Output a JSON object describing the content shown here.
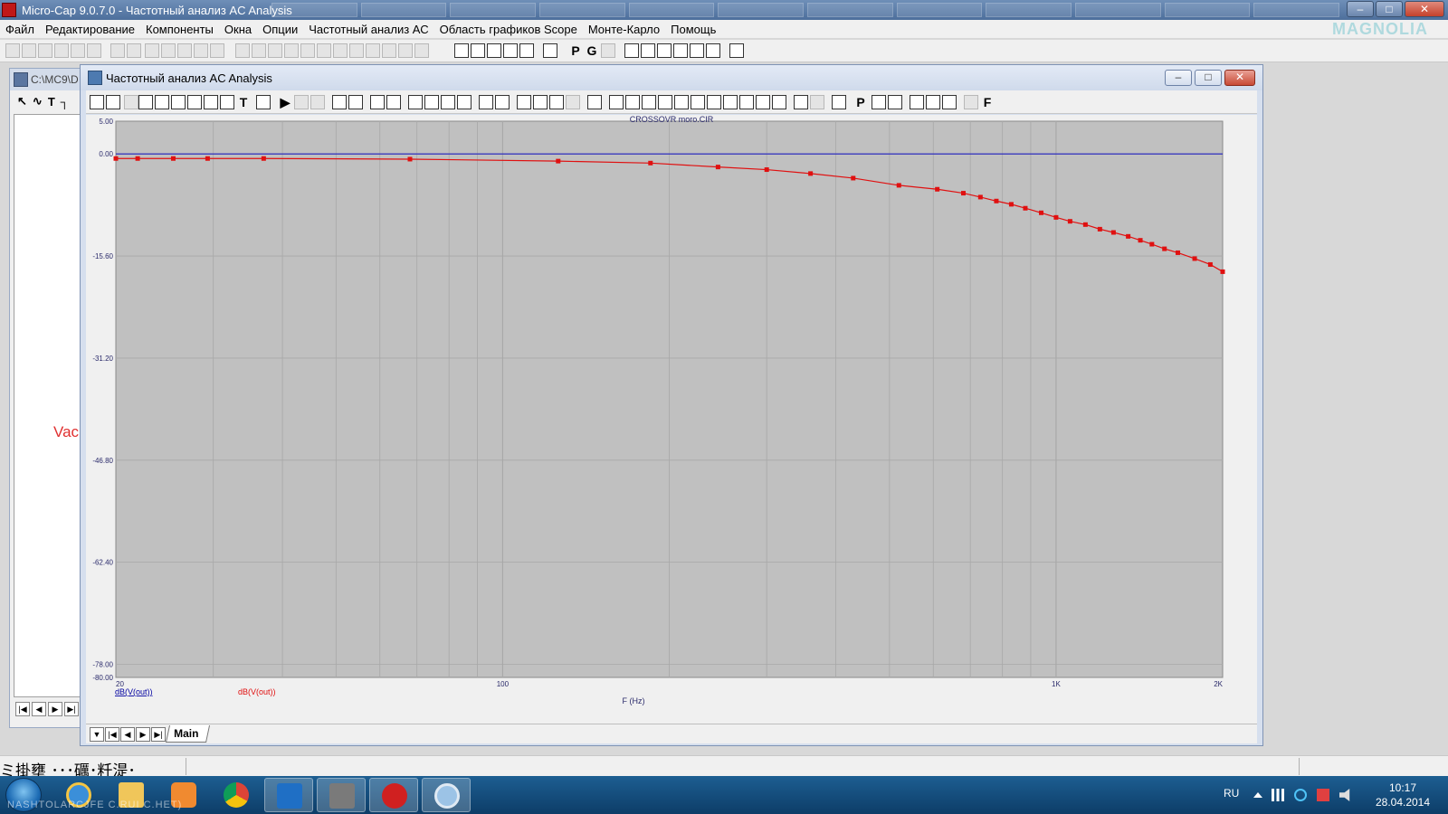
{
  "app": {
    "title": "Micro-Cap 9.0.7.0 - Частотный анализ AC Analysis",
    "brand": "MAGNOLIA"
  },
  "menu": [
    "Файл",
    "Редактирование",
    "Компоненты",
    "Окна",
    "Опции",
    "Частотный анализ АС",
    "Область графиков Scope",
    "Монте-Карло",
    "Помощь"
  ],
  "bg_window": {
    "title": "C:\\MC9\\D",
    "red_text": "Vac"
  },
  "ac_window": {
    "title": "Частотный анализ AC Analysis",
    "tab": "Main"
  },
  "toolbar_letters": {
    "p": "P",
    "g": "G",
    "f": "F",
    "t": "T"
  },
  "chart_data": {
    "type": "line",
    "title": "CROSSOVR moro.CIR",
    "xlabel": "F (Hz)",
    "x_scale": "log",
    "xlim": [
      20,
      2000
    ],
    "x_ticks": [
      20,
      100,
      1000,
      2000
    ],
    "x_tick_labels": [
      "20",
      "100",
      "1K",
      "2K"
    ],
    "ylim": [
      -80,
      5
    ],
    "y_ticks": [
      5,
      0,
      -15.6,
      -31.2,
      -46.8,
      -62.4,
      -78,
      -80
    ],
    "y_tick_labels": [
      "5.00",
      "0.00",
      "-15.60",
      "-31.20",
      "-46.80",
      "-62.40",
      "-78.00",
      "-80.00"
    ],
    "grid": true,
    "legend": [
      "dB(V(out))",
      "dB(V(out))"
    ],
    "series": [
      {
        "name": "dB(V(out))",
        "color": "#2020c0",
        "x": [
          20,
          2000
        ],
        "y": [
          0.0,
          0.0
        ]
      },
      {
        "name": "dB(V(out))",
        "color": "#e01010",
        "markers": true,
        "x": [
          20,
          21.9,
          25.4,
          29.3,
          37,
          68,
          126,
          185,
          245,
          300,
          360,
          430,
          520,
          610,
          680,
          730,
          780,
          830,
          880,
          940,
          1000,
          1060,
          1130,
          1200,
          1270,
          1350,
          1420,
          1490,
          1570,
          1660,
          1780,
          1900,
          2000
        ],
        "y": [
          -0.7,
          -0.7,
          -0.7,
          -0.7,
          -0.7,
          -0.8,
          -1.1,
          -1.4,
          -2.0,
          -2.4,
          -3.0,
          -3.7,
          -4.8,
          -5.4,
          -6.0,
          -6.6,
          -7.2,
          -7.7,
          -8.3,
          -9.0,
          -9.7,
          -10.3,
          -10.8,
          -11.5,
          -12.0,
          -12.6,
          -13.2,
          -13.8,
          -14.5,
          -15.1,
          -16.0,
          -16.9,
          -18.0
        ]
      }
    ]
  },
  "status": {
    "text": "ミ掛壅 ･･･礪･粁湜･"
  },
  "taskbar": {
    "lang": "RU",
    "time": "10:17",
    "date": "28.04.2014",
    "watermark": "NASHTOLARCJFE C.RUI C.HET)"
  },
  "colors": {
    "plot_bg": "#c0c0c0",
    "grid": "#a8a8a8",
    "series_blue": "#2020c0",
    "series_red": "#e01010",
    "legend": "#0000a0"
  }
}
